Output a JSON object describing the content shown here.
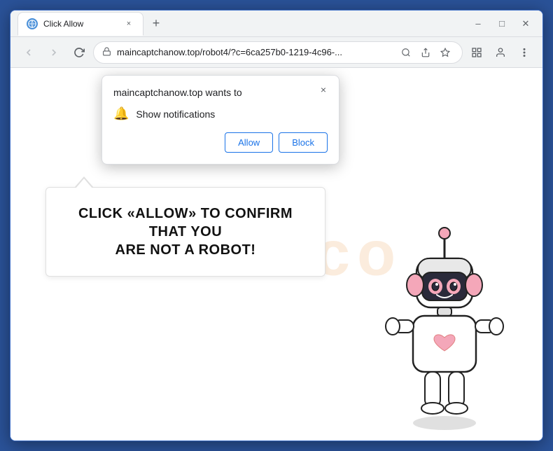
{
  "window": {
    "title": "Click Allow",
    "tab_favicon": "🌐",
    "tab_close_label": "×",
    "new_tab_label": "+"
  },
  "window_controls": {
    "minimize": "–",
    "maximize": "□",
    "close": "✕"
  },
  "nav": {
    "back_label": "←",
    "forward_label": "→",
    "reload_label": "↻",
    "address": "maincaptchanow.top/robot4/?c=6ca257b0-1219-4c96-...",
    "lock_icon": "🔒"
  },
  "nav_icons": {
    "search": "🔍",
    "share": "↗",
    "star": "☆",
    "extension": "□",
    "profile": "◯",
    "menu": "⋮"
  },
  "popup": {
    "title": "maincaptchanow.top wants to",
    "notification_text": "Show notifications",
    "allow_label": "Allow",
    "block_label": "Block",
    "close_label": "×"
  },
  "captcha": {
    "line1": "CLICK «ALLOW» TO CONFIRM THAT YOU",
    "line2": "ARE NOT A ROBOT!"
  },
  "watermark": {
    "text": "risk.co"
  },
  "colors": {
    "chrome_blue": "#2a5298",
    "allow_color": "#1a73e8",
    "block_color": "#1a73e8",
    "captcha_text": "#111111"
  }
}
